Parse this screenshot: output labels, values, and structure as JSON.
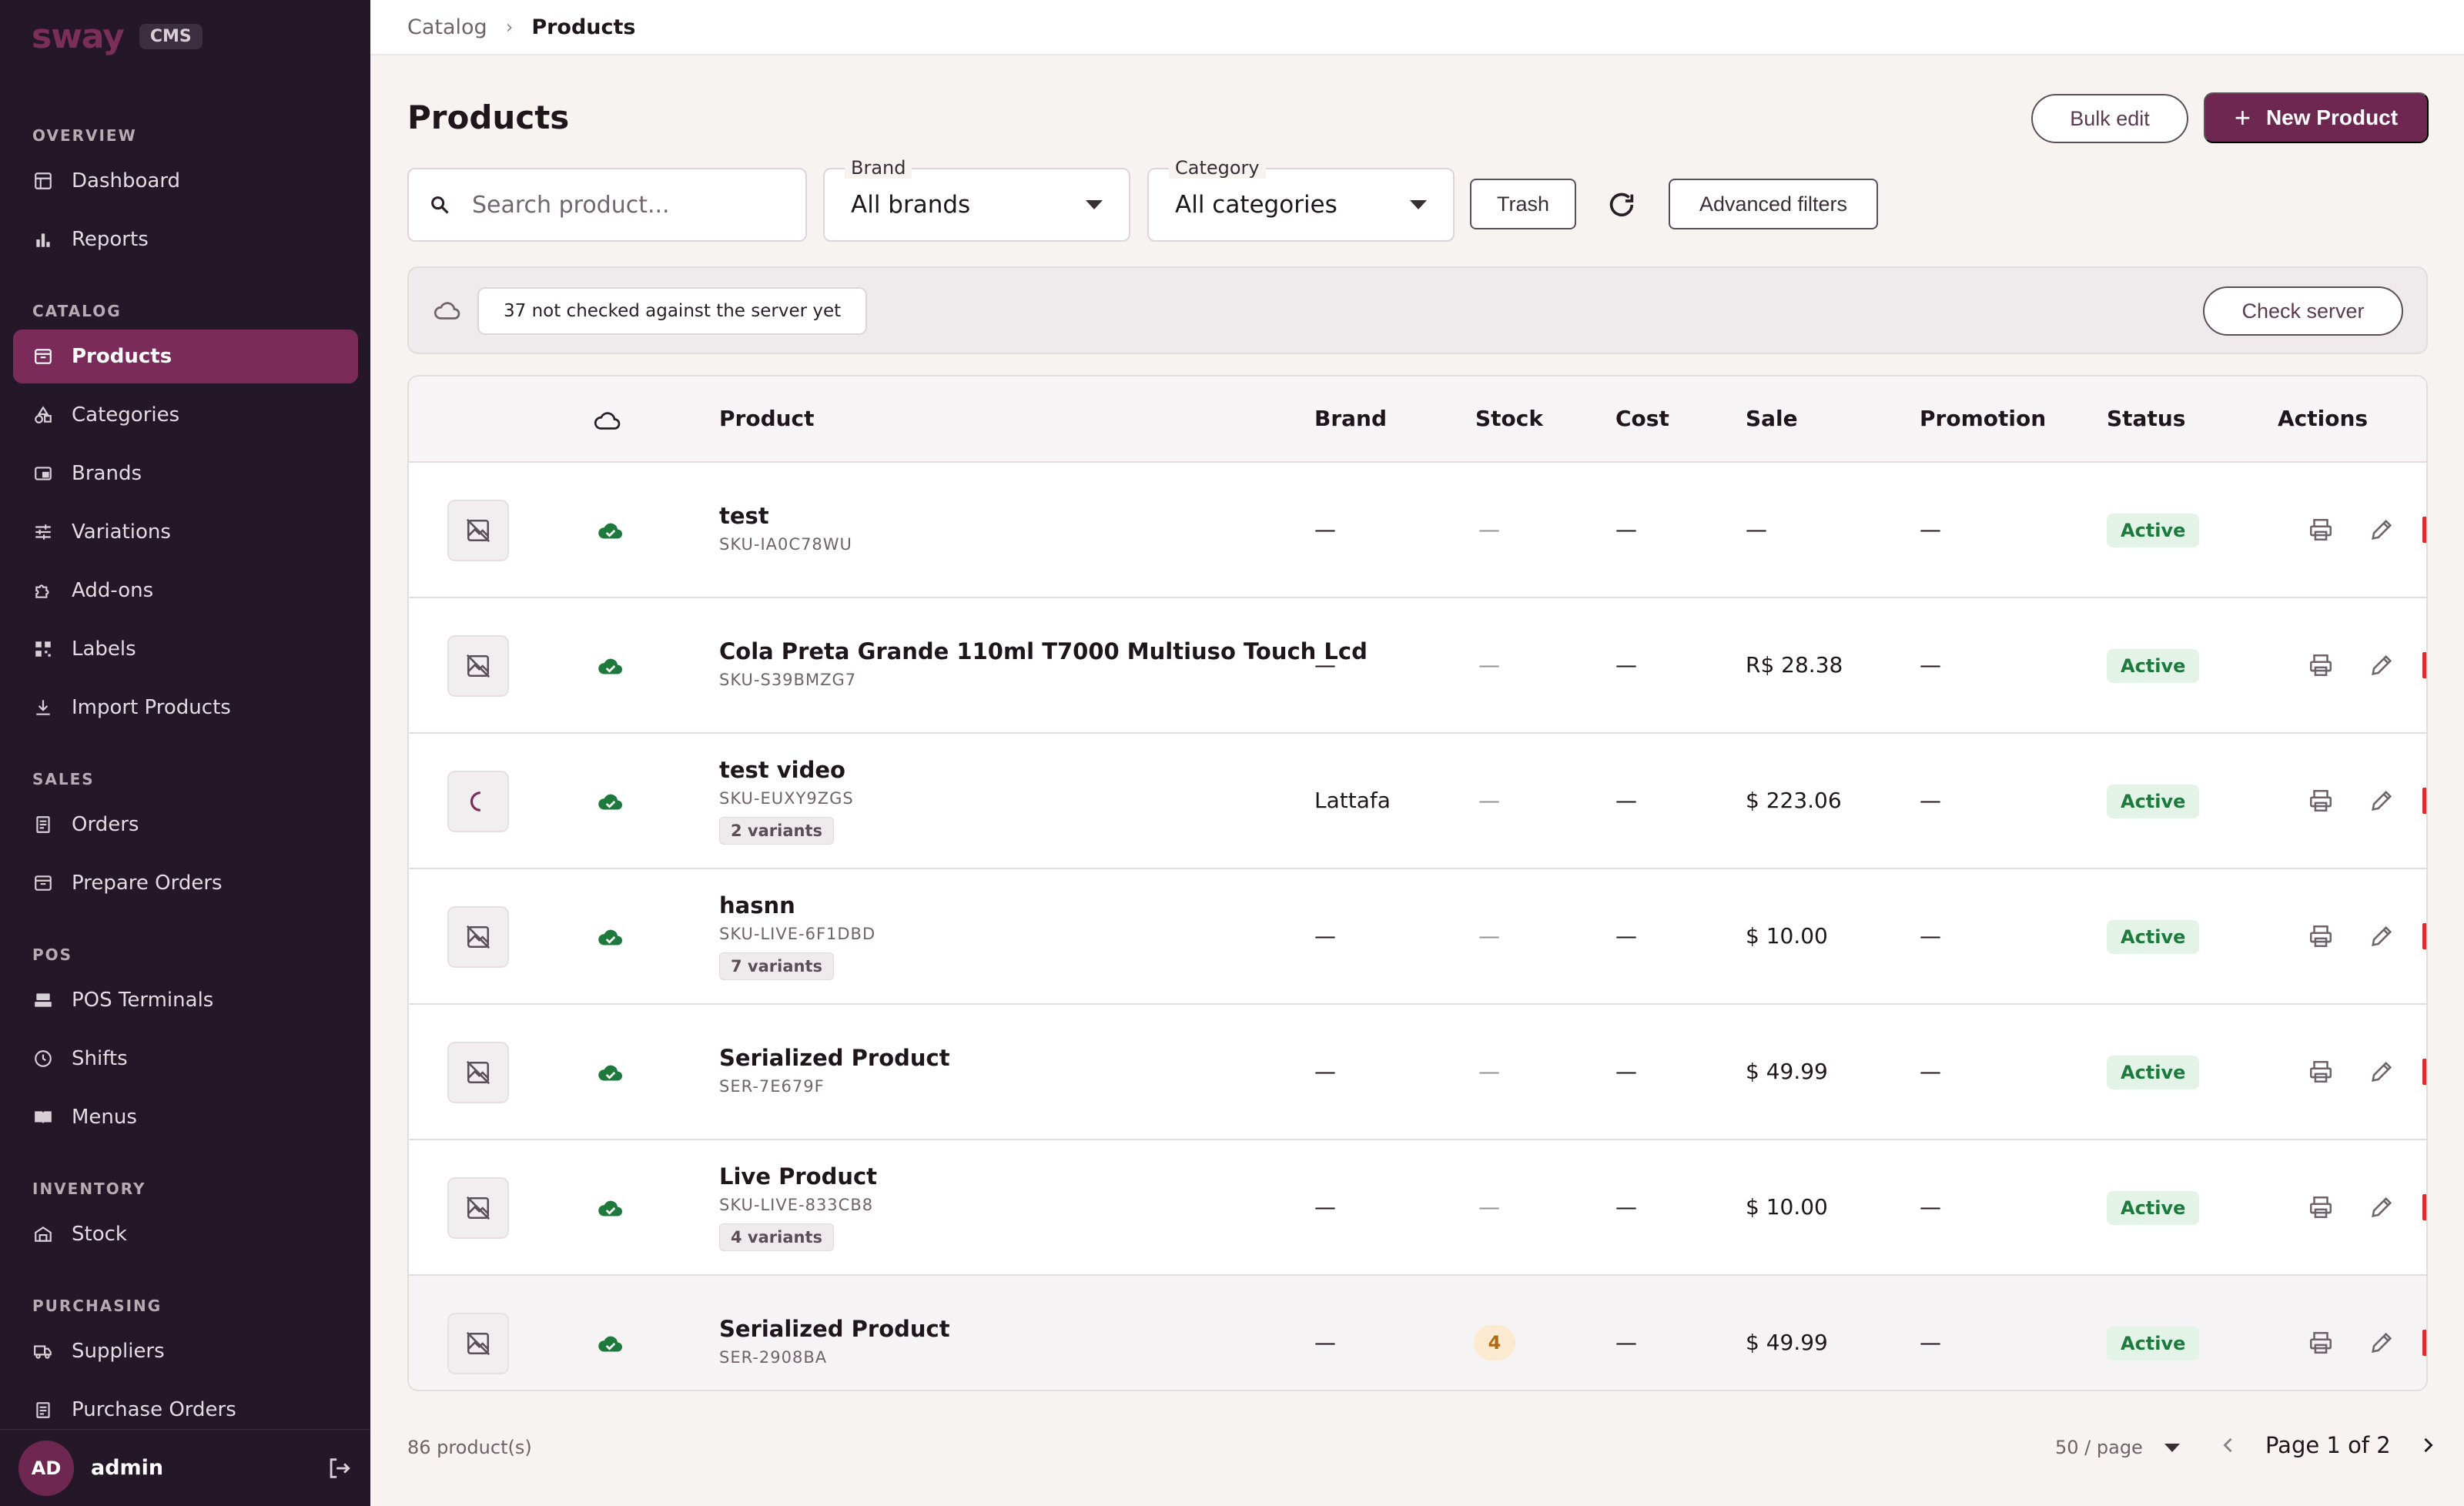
{
  "sidebar": {
    "logo": "sway",
    "badge": "CMS",
    "sections": {
      "overview": "OVERVIEW",
      "catalog": "CATALOG",
      "sales": "SALES",
      "pos": "POS",
      "inventory": "INVENTORY",
      "purchasing": "PURCHASING"
    },
    "items": {
      "dashboard": "Dashboard",
      "reports": "Reports",
      "products": "Products",
      "categories": "Categories",
      "brands": "Brands",
      "variations": "Variations",
      "addons": "Add-ons",
      "labels": "Labels",
      "import_products": "Import Products",
      "orders": "Orders",
      "prepare_orders": "Prepare Orders",
      "pos_terminals": "POS Terminals",
      "shifts": "Shifts",
      "menus": "Menus",
      "stock": "Stock",
      "suppliers": "Suppliers",
      "purchase_orders": "Purchase Orders"
    },
    "user": {
      "initials": "AD",
      "name": "admin"
    }
  },
  "breadcrumb": {
    "parent": "Catalog",
    "current": "Products"
  },
  "page": {
    "title": "Products",
    "bulk_edit": "Bulk edit",
    "new_product": "New Product"
  },
  "filters": {
    "search_placeholder": "Search product...",
    "brand_label": "Brand",
    "brand_value": "All brands",
    "category_label": "Category",
    "category_value": "All categories",
    "trash": "Trash",
    "advanced": "Advanced filters"
  },
  "sync": {
    "message": "37 not checked against the server yet",
    "check_server": "Check server"
  },
  "table": {
    "headers": {
      "product": "Product",
      "brand": "Brand",
      "stock": "Stock",
      "cost": "Cost",
      "sale": "Sale",
      "promotion": "Promotion",
      "status": "Status",
      "actions": "Actions"
    },
    "rows": [
      {
        "name": "test",
        "sku": "SKU-IA0C78WU",
        "variants": "",
        "brand": "—",
        "stock": "—",
        "cost": "—",
        "sale": "—",
        "promotion": "—",
        "status": "Active"
      },
      {
        "name": "Cola Preta Grande 110ml T7000 Multiuso Touch Lcd",
        "sku": "SKU-S39BMZG7",
        "variants": "",
        "brand": "—",
        "stock": "—",
        "cost": "—",
        "sale": "R$ 28.38",
        "promotion": "—",
        "status": "Active"
      },
      {
        "name": "test video",
        "sku": "SKU-EUXY9ZGS",
        "variants": "2 variants",
        "brand": "Lattafa",
        "stock": "—",
        "cost": "—",
        "sale": "$ 223.06",
        "promotion": "—",
        "status": "Active"
      },
      {
        "name": "hasnn",
        "sku": "SKU-LIVE-6F1DBD",
        "variants": "7 variants",
        "brand": "—",
        "stock": "—",
        "cost": "—",
        "sale": "$ 10.00",
        "promotion": "—",
        "status": "Active"
      },
      {
        "name": "Serialized Product",
        "sku": "SER-7E679F",
        "variants": "",
        "brand": "—",
        "stock": "—",
        "cost": "—",
        "sale": "$ 49.99",
        "promotion": "—",
        "status": "Active"
      },
      {
        "name": "Live Product",
        "sku": "SKU-LIVE-833CB8",
        "variants": "4 variants",
        "brand": "—",
        "stock": "—",
        "cost": "—",
        "sale": "$ 10.00",
        "promotion": "—",
        "status": "Active"
      },
      {
        "name": "Serialized Product",
        "sku": "SER-2908BA",
        "variants": "",
        "brand": "—",
        "stock": "4",
        "cost": "—",
        "sale": "$ 49.99",
        "promotion": "—",
        "status": "Active"
      }
    ]
  },
  "footer": {
    "count": "86 product(s)",
    "per_page": "50 / page",
    "page": "Page 1 of 2"
  },
  "colors": {
    "sidebar_bg": "#241828",
    "accent": "#6d2750",
    "status_active": "#1d7a3c"
  }
}
